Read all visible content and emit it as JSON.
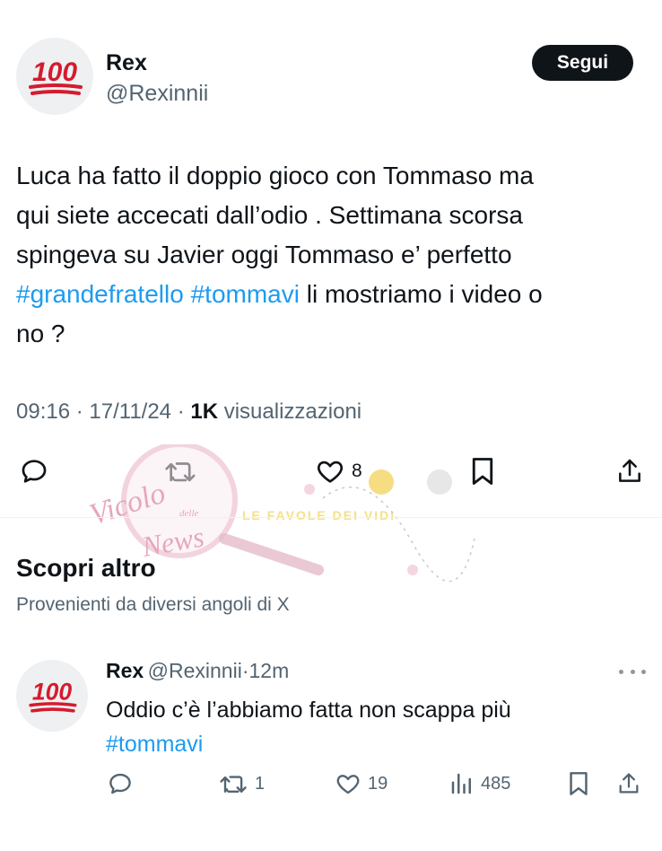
{
  "post": {
    "author_name": "Rex",
    "author_handle": "@Rexinnii",
    "avatar_icon": "hundred-points-emoji",
    "avatar_label": "100",
    "follow_label": "Segui",
    "text_line_1": "Luca ha fatto il doppio gioco con Tommaso ma",
    "text_line_2": "qui siete accecati dall’odio . Settimana scorsa",
    "text_line_3": "spingeva su Javier oggi Tommaso e’ perfetto",
    "hashtag_1": "#grandefratello",
    "hashtag_2": "#tommavi",
    "text_tail_4": "li mostriamo i video o",
    "text_line_5": "no ?",
    "time": "09:16",
    "date": "17/11/24",
    "views_count": "1K",
    "views_label": "visualizzazioni",
    "like_count": "8"
  },
  "watermark": {
    "text_1": "Vicolo",
    "text_2": "delle",
    "text_3": "News",
    "strip_text": "LE FAVOLE DEI VIDI"
  },
  "discover": {
    "title": "Scopri altro",
    "subtitle": "Provenienti da diversi angoli di X"
  },
  "reply": {
    "author_name": "Rex",
    "author_handle": "@Rexinnii",
    "separator": "·",
    "time_ago": "12m",
    "avatar_label": "100",
    "text": "Oddio c’è l’abbiamo fatta non scappa più",
    "hashtag": "#tommavi",
    "retweet_count": "1",
    "like_count": "19",
    "views_count": "485"
  },
  "colors": {
    "link": "#1d9bf0",
    "secondary_text": "#536471",
    "emoji_red": "#d41c2e",
    "button_bg": "#0f1419"
  }
}
